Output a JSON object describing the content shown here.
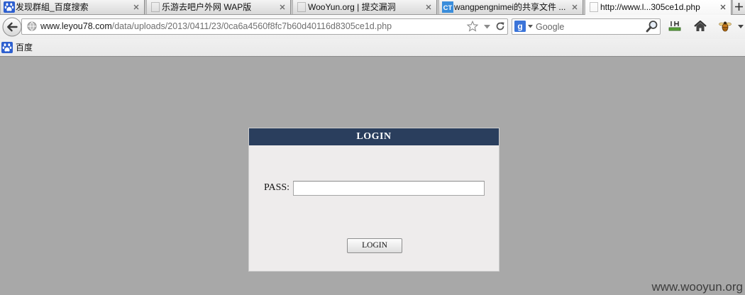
{
  "browser": {
    "tabs": [
      {
        "title": "发现群組_百度搜索",
        "icon": "baidu-paw-icon"
      },
      {
        "title": "乐游去吧户外网 WAP版",
        "icon": "blank-page-icon"
      },
      {
        "title": "WooYun.org | 提交漏洞",
        "icon": "blank-page-icon"
      },
      {
        "title": "wangpengnimei的共享文件 ...",
        "icon": "ct-icon",
        "icon_text": "CT"
      },
      {
        "title": "http://www.l...305ce1d.php",
        "icon": "blank-page-icon",
        "active": true
      }
    ],
    "tab_close_icon": "close-icon",
    "new_tab_icon": "plus-icon",
    "navigation": {
      "back_icon": "back-arrow-icon",
      "address_bar": {
        "site_icon": "globe-icon",
        "url_domain": "www.leyou78.com",
        "url_path": "/data/uploads/2013/0411/23/0ca6a4560f8fc7b60d40116d8305ce1d.php",
        "bookmark_icon": "star-icon",
        "history_icon": "dropdown-arrow-icon",
        "reload_icon": "reload-icon"
      },
      "search_bar": {
        "engine_icon": "google-icon",
        "engine_icon_text": "g",
        "placeholder": "Google",
        "go_icon": "magnifier-icon"
      },
      "toolbar_icons": [
        "bandwidth-meter-icon",
        "home-icon",
        "firebug-icon",
        "dropdown-arrow-icon"
      ]
    },
    "bookmarks": [
      {
        "label": "百度",
        "icon": "baidu-paw-icon"
      }
    ]
  },
  "page": {
    "login_panel": {
      "title": "LOGIN",
      "pass_label": "PASS:",
      "pass_value": "",
      "submit_label": "LOGIN"
    }
  },
  "watermark": "www.wooyun.org",
  "colors": {
    "page_background": "#a8a8a8",
    "login_header": "#2a3e5d",
    "login_body": "#eeecec",
    "watermark": "#3d3d3d"
  }
}
